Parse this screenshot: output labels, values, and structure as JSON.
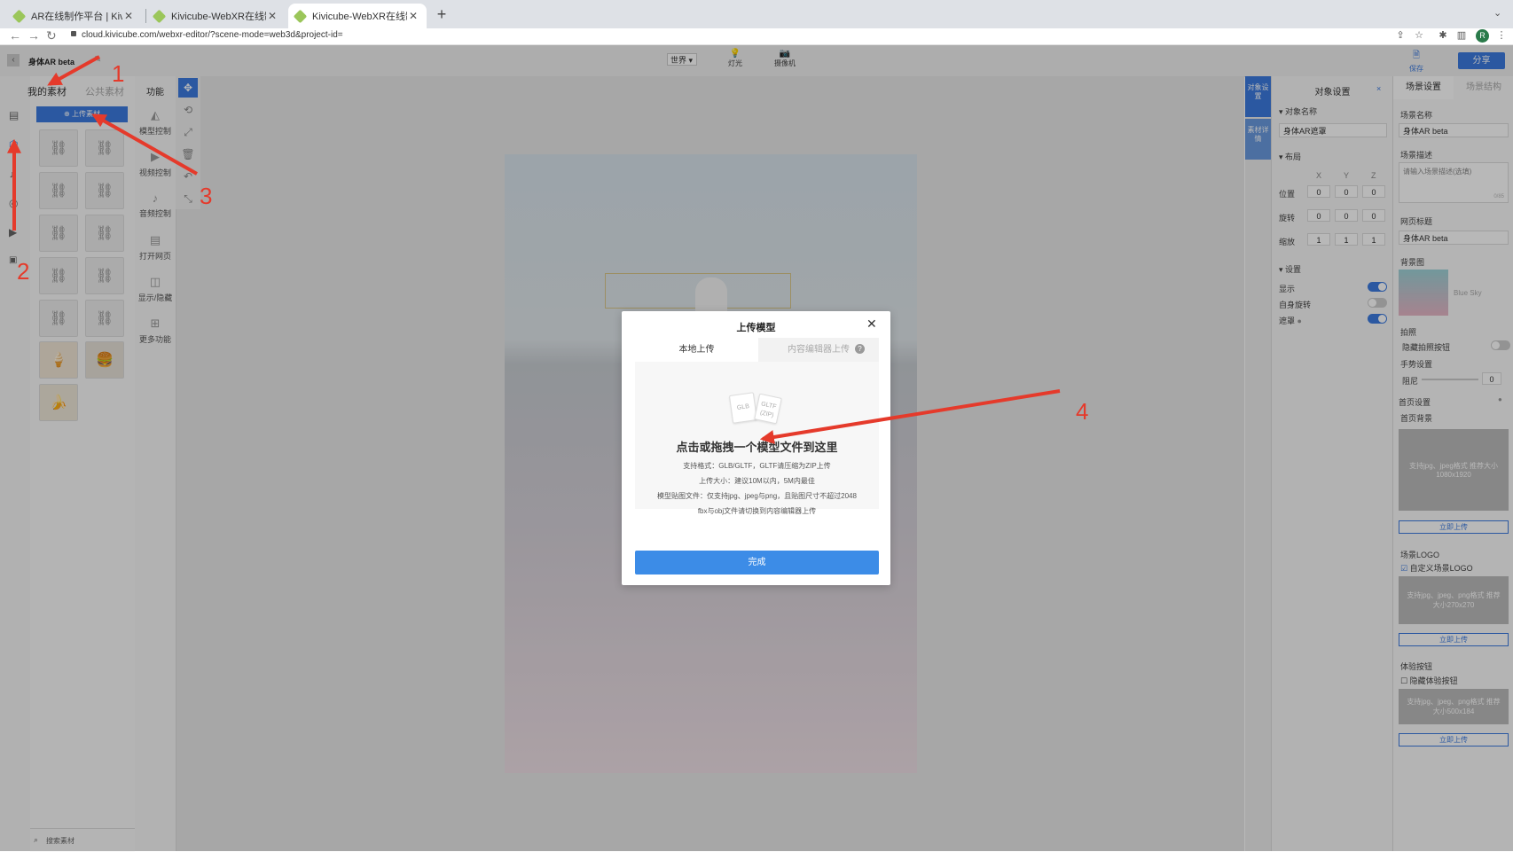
{
  "browser": {
    "tabs": [
      {
        "title": "AR在线制作平台 | Kivicube-零基"
      },
      {
        "title": "Kivicube-WebXR在线制作平台"
      },
      {
        "title": "Kivicube-WebXR在线制作平台"
      }
    ],
    "url": "cloud.kivicube.com/webxr-editor/?scene-mode=web3d&project-id=",
    "avatar_letter": "R"
  },
  "header": {
    "project_name": "身体AR beta",
    "world_select": "世界",
    "light_label": "灯光",
    "camera_label": "摄像机",
    "save_label": "保存",
    "share_label": "分享"
  },
  "assets": {
    "tab_mine": "我的素材",
    "tab_public": "公共素材",
    "upload_label": "上传素材",
    "search_placeholder": "搜索素材"
  },
  "functions": {
    "title": "功能",
    "items": [
      {
        "label": "模型控制"
      },
      {
        "label": "视频控制"
      },
      {
        "label": "音频控制"
      },
      {
        "label": "打开网页"
      },
      {
        "label": "显示/隐藏"
      },
      {
        "label": "更多功能"
      }
    ]
  },
  "object_settings": {
    "side_tab1": "对象设置",
    "side_tab2": "素材详情",
    "title": "对象设置",
    "name_section": "对象名称",
    "name_value": "身体AR遮罩",
    "layout_section": "布局",
    "axes": [
      "X",
      "Y",
      "Z"
    ],
    "position_label": "位置",
    "position": [
      "0",
      "0",
      "0"
    ],
    "rotation_label": "旋转",
    "rotation": [
      "0",
      "0",
      "0"
    ],
    "scale_label": "缩放",
    "scale": [
      "1",
      "1",
      "1"
    ],
    "settings_section": "设置",
    "show_label": "显示",
    "show_on": true,
    "self_rotate_label": "自身旋转",
    "self_rotate_on": false,
    "mask_label": "遮罩",
    "mask_on": true
  },
  "scene_settings": {
    "tab_scene": "场景设置",
    "tab_structure": "场景结构",
    "scene_name_label": "场景名称",
    "scene_name": "身体AR beta",
    "desc_label": "场景描述",
    "desc_placeholder": "请输入场景描述(选填)",
    "desc_count": "0/85",
    "page_title_label": "网页标题",
    "page_title": "身体AR beta",
    "bg_label": "背景图",
    "bg_name": "Blue Sky",
    "photo_label": "拍照",
    "hide_photo_label": "隐藏拍照按钮",
    "gesture_label": "手势设置",
    "damping_label": "阻尼",
    "damping_value": "0",
    "home_label": "首页设置",
    "home_bg_label": "首页背景",
    "home_bg_hint": "支持jpg、jpeg格式 推荐大小1080x1920",
    "upload_now": "立即上传",
    "logo_label": "场景LOGO",
    "custom_logo_label": "自定义场景LOGO",
    "logo_hint": "支持jpg、jpeg、png格式 推荐大小270x270",
    "exp_btn_label": "体验按钮",
    "hide_exp_label": "隐藏体验按钮",
    "exp_hint": "支持jpg、jpeg、png格式 推荐大小500x184"
  },
  "modal": {
    "title": "上传模型",
    "tab_local": "本地上传",
    "tab_editor": "内容编辑器上传",
    "file1": "GLB",
    "file2": "GLTF (ZIP)",
    "drop_text": "点击或拖拽一个模型文件到这里",
    "lines": [
      "支持格式：GLB/GLTF，GLTF请压缩为ZIP上传",
      "上传大小：建议10M以内，5M内最佳",
      "模型贴图文件：仅支持jpg、jpeg与png，且贴图尺寸不超过2048",
      "fbx与obj文件请切换到内容编辑器上传"
    ],
    "done_label": "完成"
  },
  "annotations": [
    "1",
    "2",
    "3",
    "4"
  ],
  "colors": {
    "accent": "#3c8ce7",
    "annotation": "#e53a2b"
  }
}
